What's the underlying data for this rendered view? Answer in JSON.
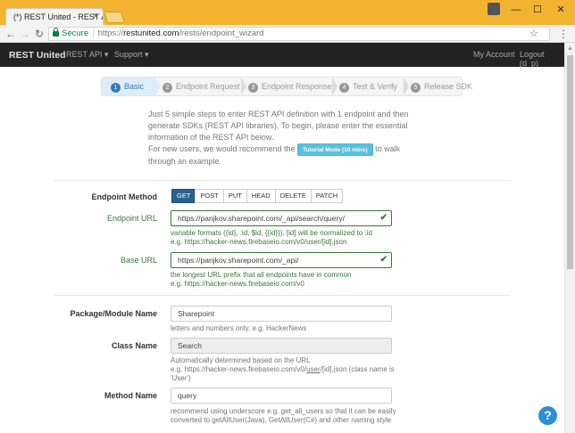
{
  "browser": {
    "tab_title": "(*) REST United - REST API",
    "tab_close": "×",
    "win_minimize": "—",
    "win_maximize": "☐",
    "win_close": "✕",
    "back": "←",
    "forward": "→",
    "reload": "↻",
    "secure_label": "Secure",
    "url_scheme": "https://",
    "url_host": "restunited.com",
    "url_path": "/rests/endpoint_wizard",
    "star": "☆",
    "menu": "⋮"
  },
  "navbar": {
    "brand": "REST United",
    "rest_api": "REST API ▾",
    "support": "Support ▾",
    "my_account": "My Account",
    "logout": "Logout (d_p)"
  },
  "steps": [
    {
      "num": "1",
      "label": "Basic"
    },
    {
      "num": "2",
      "label": "Endpoint Request"
    },
    {
      "num": "3",
      "label": "Endpoint Response"
    },
    {
      "num": "4",
      "label": "Test & Verify"
    },
    {
      "num": "5",
      "label": "Release SDK"
    }
  ],
  "intro": {
    "line1": "Just 5 simple steps to enter REST API definition with 1 endpoint and then generate SDKs (REST API libraries). To begin, please enter the essential information of the REST API below.",
    "line2_before": "For new users, we would recommend the",
    "tutorial_button": "Tutorial Mode (10 mins)",
    "line2_after": "to walk through an example."
  },
  "form": {
    "endpoint_method": {
      "label": "Endpoint Method",
      "options": [
        "GET",
        "POST",
        "PUT",
        "HEAD",
        "DELETE",
        "PATCH"
      ]
    },
    "endpoint_url": {
      "label": "Endpoint URL",
      "value": "https://panjkov.sharepoint.com/_api/search/query/",
      "help1": "variable formats ({id}, :id, $id, {{id}}), [id] will be normalized to :id",
      "help2": "e.g. https://hacker-news.firebaseio.com/v0/user/[id].json"
    },
    "base_url": {
      "label": "Base URL",
      "value": "https://panjkov.sharepoint.com/_api/",
      "help1": "the longest URL prefix that all endpoints have in common",
      "help2": "e.g. https://hacker-news.firebaseio.com/v0"
    },
    "package_name": {
      "label": "Package/Module Name",
      "value": "Sharepoint",
      "help": "letters and numbers only. e.g. HackerNews"
    },
    "class_name": {
      "label": "Class Name",
      "value": "Search",
      "help1": "Automatically determined based on the URL",
      "help2_a": "e.g. https://hacker-news.firebaseio.com/v0/",
      "help2_u": "user",
      "help2_b": "/[id].json (class name is",
      "help3": "'User')"
    },
    "method_name": {
      "label": "Method Name",
      "value": "query",
      "help1": "recommend using underscore e.g. get_all_users so that it can be easily",
      "help2": "converted to getAllUser(Java), GetAllUser(C#) and other naming style"
    }
  },
  "help_bubble": "?"
}
